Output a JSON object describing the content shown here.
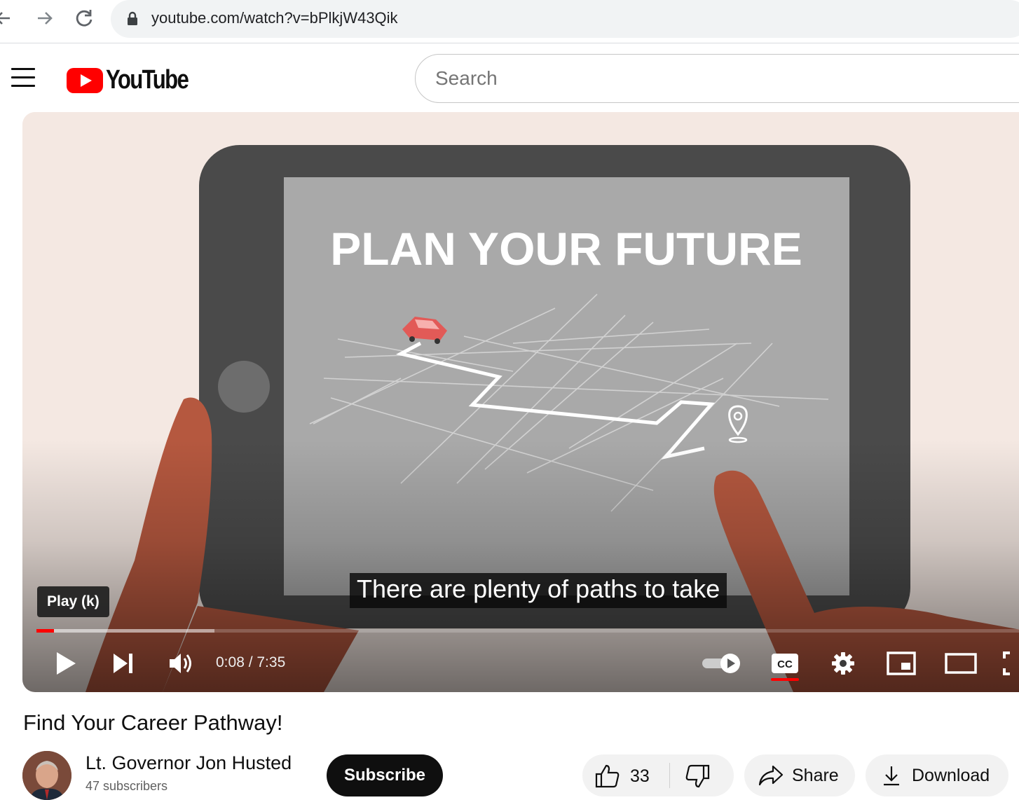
{
  "browser": {
    "url": "youtube.com/watch?v=bPlkjW43Qik"
  },
  "header": {
    "logo_text": "YouTube",
    "search_placeholder": "Search"
  },
  "player": {
    "video_heading": "PLAN YOUR FUTURE",
    "caption": "There are plenty of paths to take",
    "tooltip": "Play (k)",
    "time_display": "0:08 / 7:35",
    "progress_played_fraction": 0.018,
    "progress_loaded_fraction": 0.18,
    "autoplay_on": true,
    "captions_on": true,
    "colors": {
      "accent": "#ff0000",
      "background": "#f4e8e2",
      "tablet": "#4a4a4a",
      "screen": "#a8a8a8",
      "hand": "#b5583f"
    }
  },
  "video": {
    "title": "Find Your Career Pathway!",
    "channel_name": "Lt. Governor Jon Husted",
    "subscribers": "47 subscribers",
    "subscribe_label": "Subscribe",
    "like_count": "33",
    "share_label": "Share",
    "download_label": "Download"
  }
}
